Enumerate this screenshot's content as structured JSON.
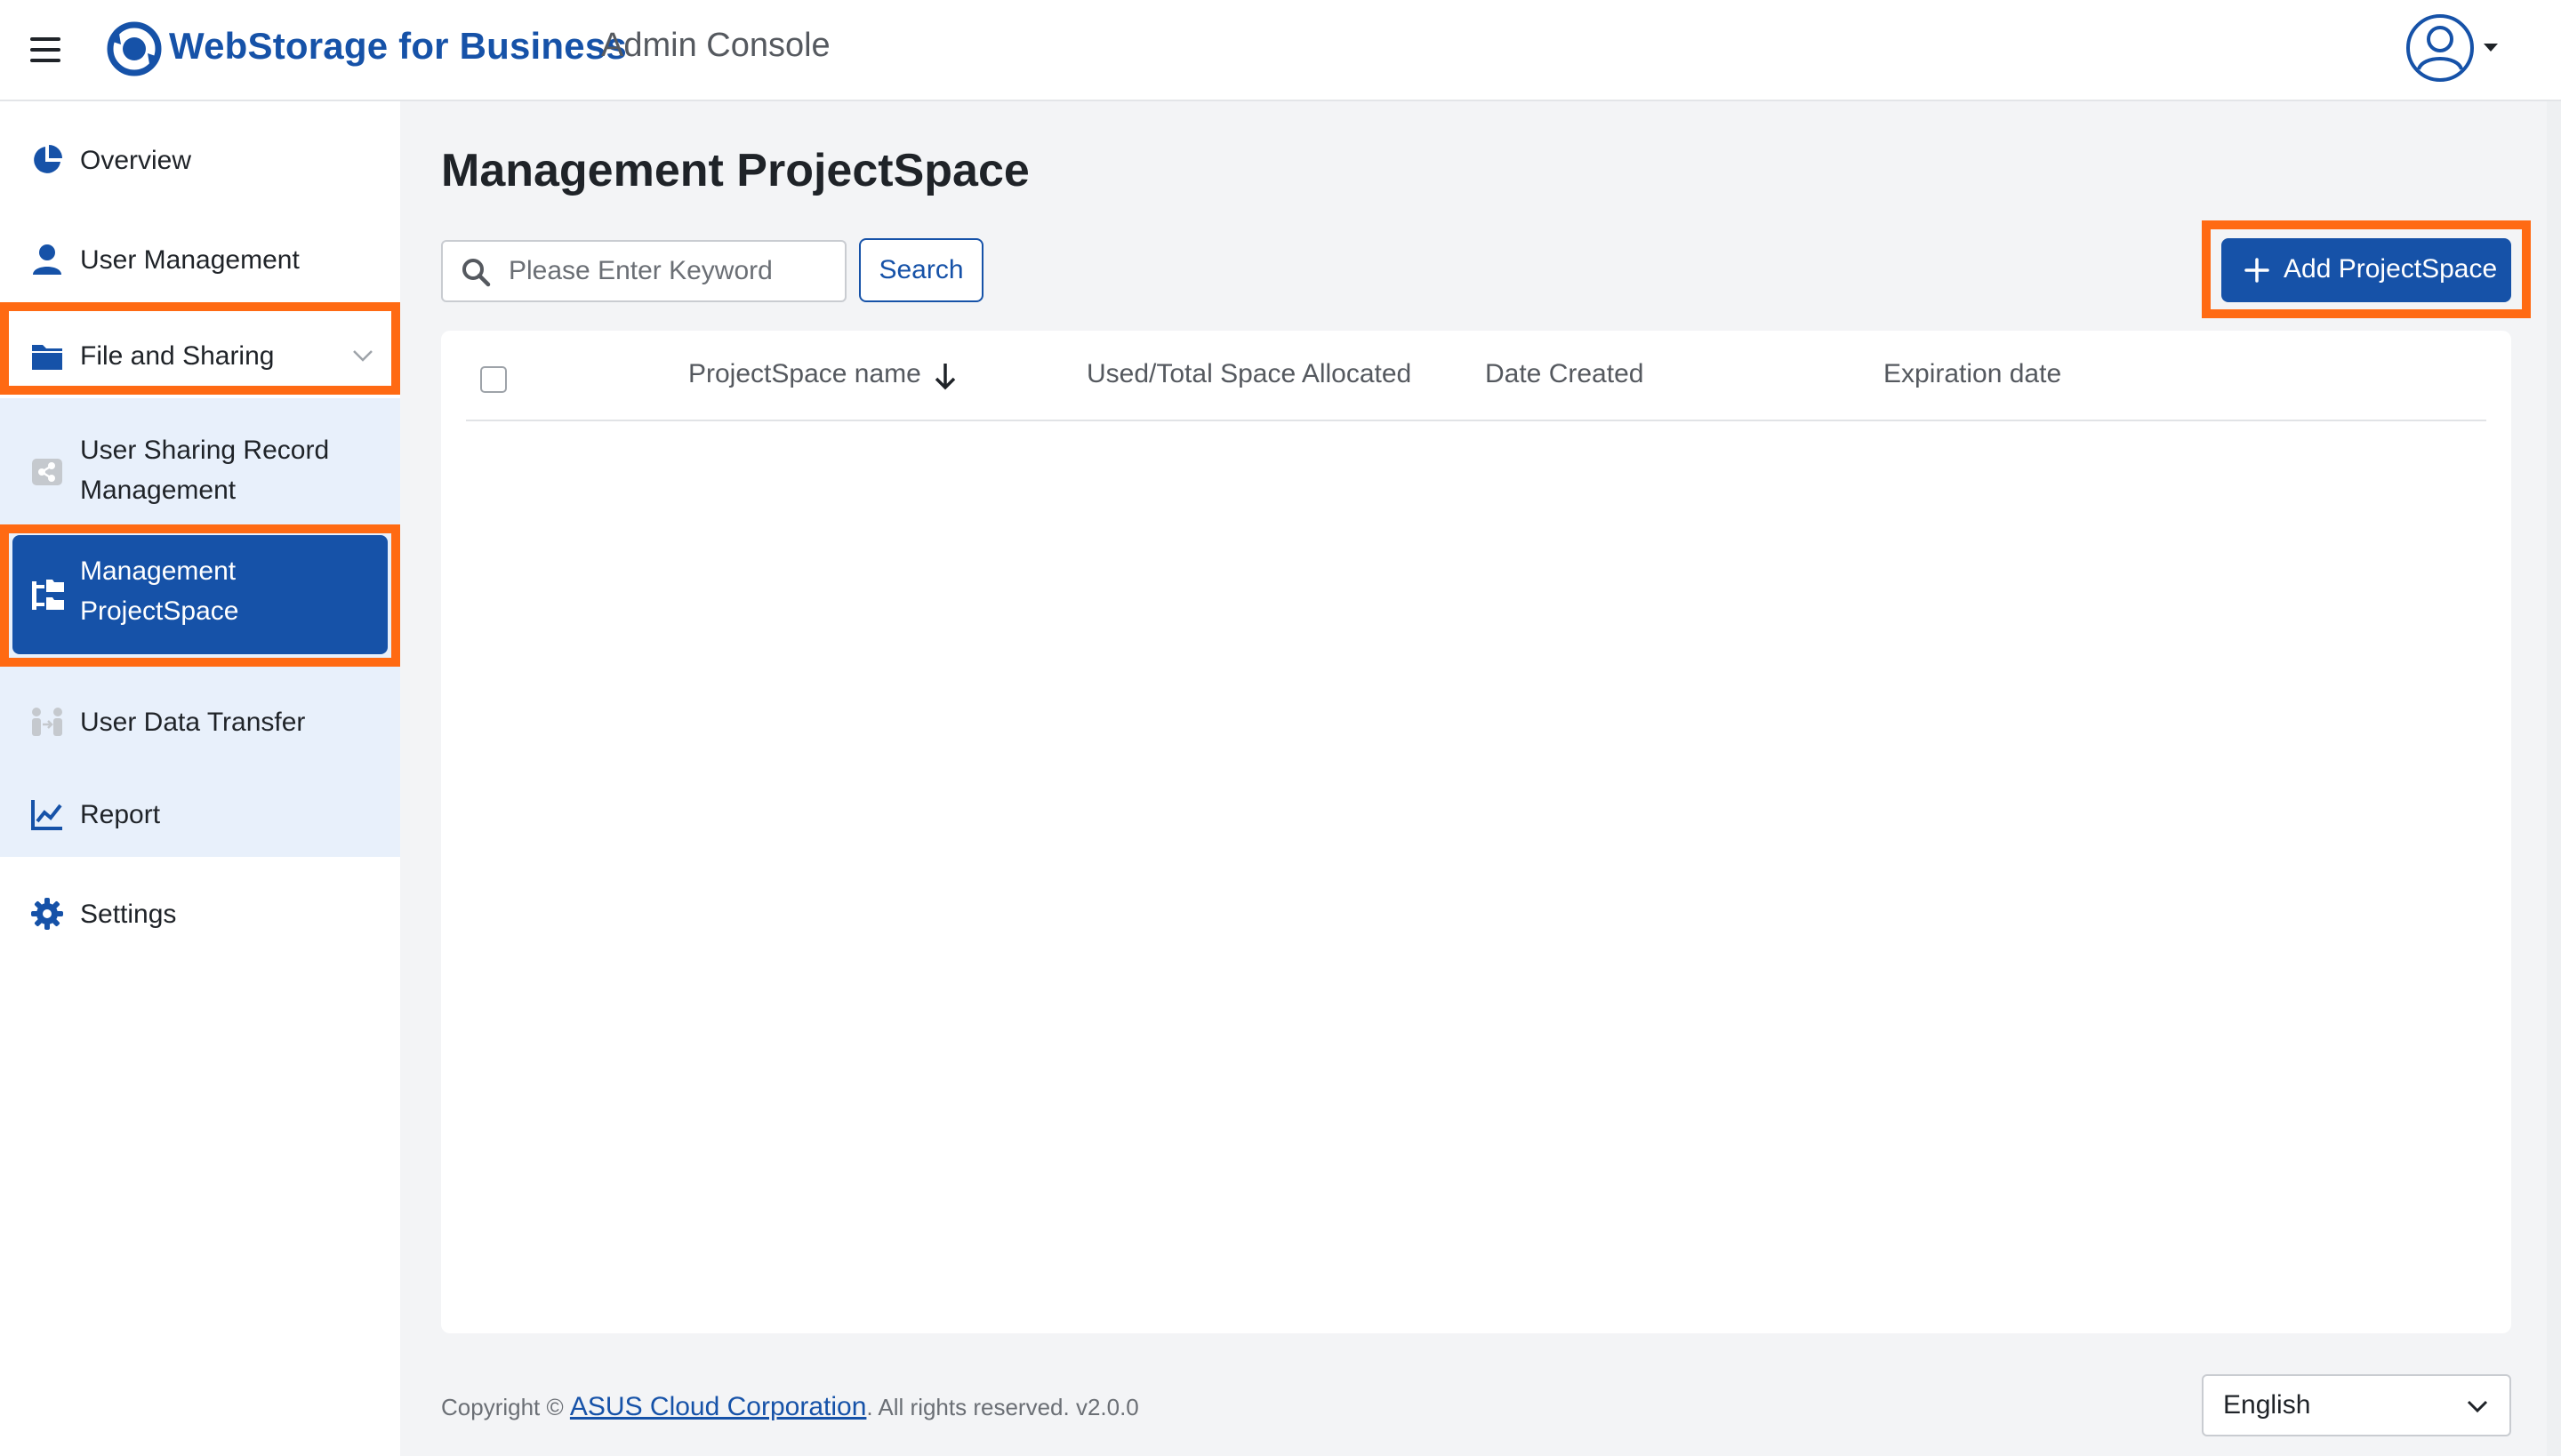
{
  "header": {
    "brand": "WebStorage for Business",
    "subtitle": "Admin Console",
    "menu_icon": "hamburger-menu-icon",
    "logo_icon": "webstorage-logo-icon",
    "avatar_icon": "user-avatar-icon"
  },
  "sidebar": {
    "items": [
      {
        "label": "Overview",
        "icon": "pie-chart-icon"
      },
      {
        "label": "User Management",
        "icon": "person-icon"
      },
      {
        "label": "File and Sharing",
        "icon": "folder-icon",
        "expanded": true
      },
      {
        "label_line1": "User Sharing Record",
        "label_line2": "Management",
        "icon": "share-icon"
      },
      {
        "label_line1": "Management",
        "label_line2": "ProjectSpace",
        "icon": "project-tree-icon",
        "active": true
      },
      {
        "label": "User Data Transfer",
        "icon": "user-transfer-icon"
      },
      {
        "label": "Report",
        "icon": "line-chart-icon"
      },
      {
        "label": "Settings",
        "icon": "gear-icon"
      }
    ]
  },
  "main": {
    "title": "Management ProjectSpace",
    "search": {
      "placeholder": "Please Enter Keyword",
      "value": "",
      "button_label": "Search"
    },
    "add_button_label": "Add ProjectSpace",
    "table": {
      "columns": [
        "ProjectSpace name",
        "Used/Total Space Allocated",
        "Date Created",
        "Expiration date"
      ],
      "sort_column": "ProjectSpace name",
      "sort_direction": "descending",
      "rows": []
    }
  },
  "footer": {
    "copyright_prefix": "Copyright ©",
    "company_link": "ASUS Cloud Corporation",
    "copyright_suffix": ". All rights reserved. v2.0.0",
    "language": "English"
  },
  "colors": {
    "brand_blue": "#1652a8",
    "highlight_orange": "#ff6a13",
    "submenu_bg": "#e8f0fb",
    "page_bg": "#f3f4f6"
  }
}
